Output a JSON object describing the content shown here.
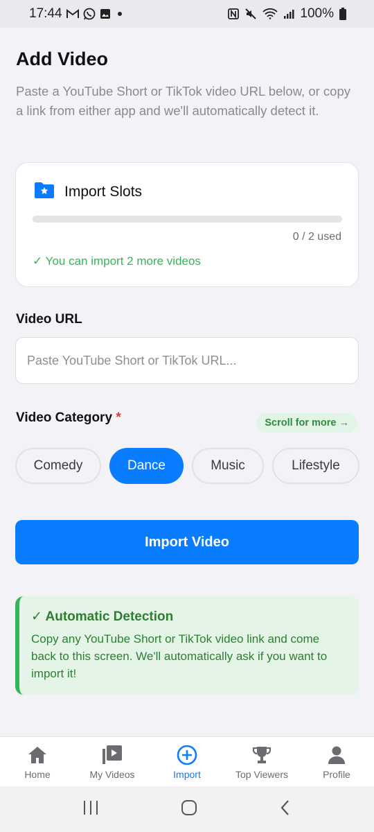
{
  "status_bar": {
    "time": "17:44",
    "battery": "100%",
    "left_icons": [
      "gmail-icon",
      "whatsapp-icon",
      "gallery-icon",
      "dot-icon"
    ],
    "right_icons": [
      "nfc-icon",
      "mute-icon",
      "wifi-icon",
      "signal-icon",
      "battery-icon"
    ]
  },
  "header": {
    "title": "Add Video",
    "description": "Paste a YouTube Short or TikTok video URL below, or copy a link from either app and we'll automatically detect it."
  },
  "import_slots": {
    "title": "Import Slots",
    "icon": "folder-star-icon",
    "used_text": "0 / 2 used",
    "used_fraction": 0,
    "status_text": "✓ You can import 2 more videos"
  },
  "video_url": {
    "label": "Video URL",
    "value": "",
    "placeholder": "Paste YouTube Short or TikTok URL..."
  },
  "category": {
    "label": "Video Category",
    "required_mark": "*",
    "scroll_hint": "Scroll for more →",
    "options": [
      "Comedy",
      "Dance",
      "Music",
      "Lifestyle"
    ],
    "selected": "Dance"
  },
  "import_button": {
    "label": "Import Video"
  },
  "auto_detect": {
    "title": "✓ Automatic Detection",
    "text": "Copy any YouTube Short or TikTok video link and come back to this screen. We'll automatically ask if you want to import it!"
  },
  "bottom_nav": {
    "items": [
      {
        "label": "Home",
        "icon": "home-icon"
      },
      {
        "label": "My Videos",
        "icon": "video-library-icon"
      },
      {
        "label": "Import",
        "icon": "plus-circle-icon"
      },
      {
        "label": "Top Viewers",
        "icon": "trophy-icon"
      },
      {
        "label": "Profile",
        "icon": "person-icon"
      }
    ],
    "active": "Import"
  },
  "colors": {
    "accent": "#0a7cff",
    "success": "#34b55a",
    "success_bg": "#e4f4e6",
    "required": "#e53935"
  }
}
